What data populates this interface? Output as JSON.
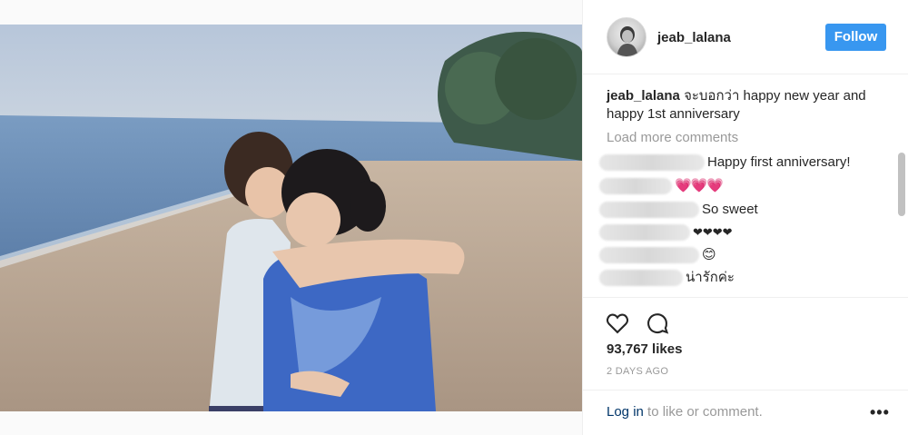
{
  "post": {
    "username": "jeab_lalana",
    "follow_label": "Follow",
    "caption_user": "jeab_lalana",
    "caption_text": "จะบอกว่า happy new year and happy 1st anniversary",
    "load_more": "Load more comments",
    "comments": [
      {
        "text": "Happy first anniversary!"
      },
      {
        "text": "💗💗💗"
      },
      {
        "text": "So sweet"
      },
      {
        "text": "❤❤❤❤"
      },
      {
        "text": "😊"
      },
      {
        "text": "น่ารักค่ะ"
      }
    ],
    "likes": "93,767 likes",
    "time": "2 DAYS AGO",
    "login_link": "Log in",
    "login_rest": " to like or comment.",
    "more_label": "•••"
  },
  "icons": [
    "heart-icon",
    "comment-icon",
    "more-icon"
  ],
  "colors": {
    "follow": "#3897f0",
    "muted": "#999999",
    "link": "#003569"
  }
}
